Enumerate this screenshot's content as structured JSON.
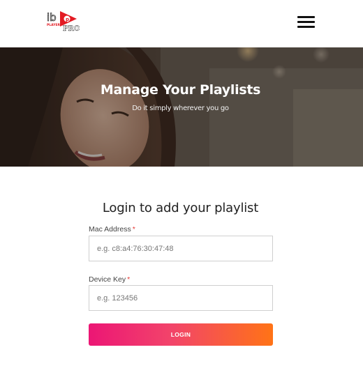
{
  "brand": {
    "logo_text": "ibo PLAYER PRO",
    "logo_color": "#e31b23"
  },
  "header": {
    "menu_icon": "hamburger-menu-icon"
  },
  "hero": {
    "title": "Manage Your Playlists",
    "subtitle": "Do it simply wherever you go"
  },
  "form": {
    "title": "Login to add your playlist",
    "mac_address": {
      "label": "Mac Address",
      "required_mark": "*",
      "placeholder": "e.g. c8:a4:76:30:47:48",
      "value": ""
    },
    "device_key": {
      "label": "Device Key",
      "required_mark": "*",
      "placeholder": "e.g. 123456",
      "value": ""
    },
    "login_label": "LOGIN"
  },
  "colors": {
    "button_gradient_start": "#ec1675",
    "button_gradient_end": "#ff7316",
    "required": "#e53935"
  }
}
